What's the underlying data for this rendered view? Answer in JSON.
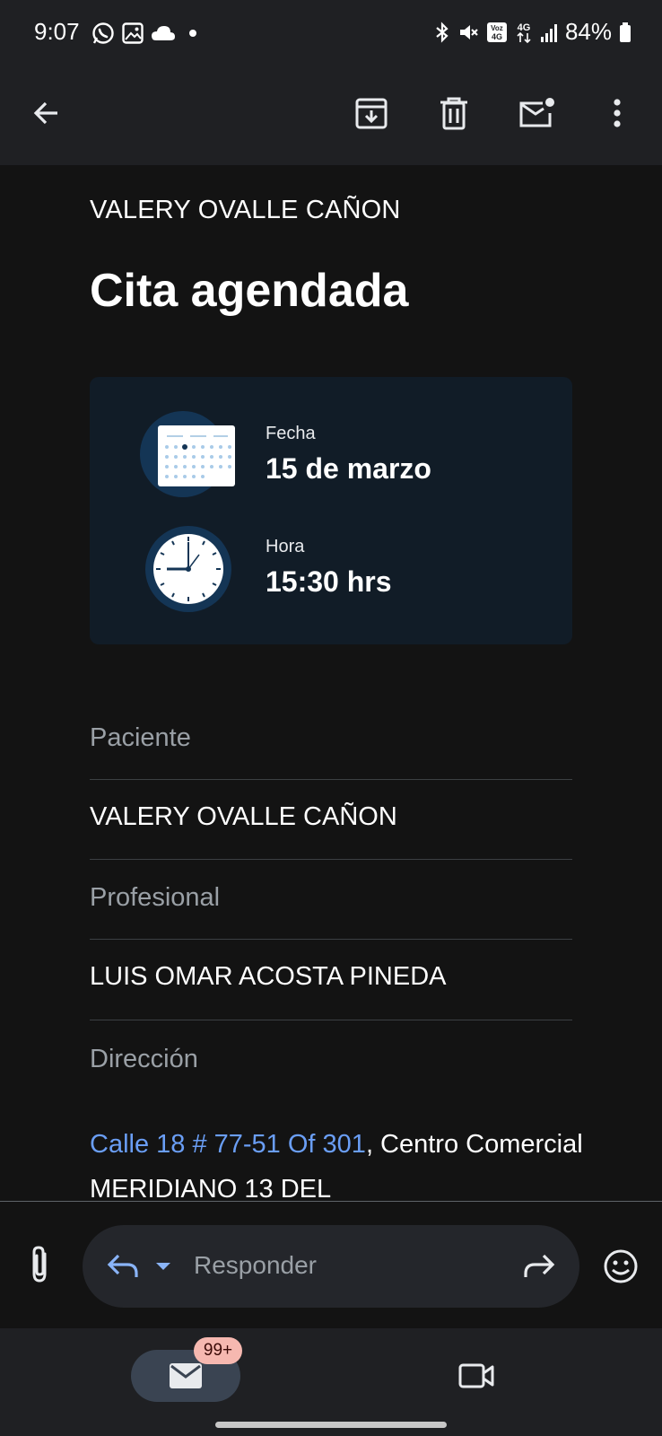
{
  "status_bar": {
    "time": "9:07",
    "left_icons": [
      "whatsapp-icon",
      "image-icon",
      "cloud-icon",
      "dot-icon"
    ],
    "right_icons": [
      "bluetooth-icon",
      "mute-icon",
      "volte-icon",
      "4g-icon",
      "signal-icon"
    ],
    "network_volte": "Voz 4G",
    "network_type": "4G",
    "battery": "84%"
  },
  "toolbar": {
    "back_icon": "arrow-back-icon",
    "archive_icon": "archive-icon",
    "delete_icon": "trash-icon",
    "mark_unread_icon": "mail-unread-icon",
    "more_icon": "more-vert-icon"
  },
  "email": {
    "sender": "VALERY OVALLE CAÑON",
    "title": "Cita agendada",
    "appointment": {
      "date_label": "Fecha",
      "date_value": "15 de marzo",
      "time_label": "Hora",
      "time_value": "15:30 hrs"
    },
    "fields": {
      "patient_label": "Paciente",
      "patient_value": "VALERY OVALLE CAÑON",
      "professional_label": "Profesional",
      "professional_value": "LUIS OMAR ACOSTA PINEDA",
      "address_label": "Dirección",
      "address_link": "Calle 18 # 77-51 Of 301",
      "address_rest": ", Centro Comercial MERIDIANO 13 DEL"
    }
  },
  "reply_bar": {
    "placeholder": "Responder",
    "attach_icon": "paperclip-icon",
    "reply_icon": "reply-icon",
    "dropdown_icon": "caret-down-icon",
    "forward_icon": "forward-icon",
    "emoji_icon": "emoji-icon"
  },
  "bottom_nav": {
    "mail_icon": "mail-icon",
    "mail_badge": "99+",
    "meet_icon": "video-icon"
  },
  "colors": {
    "background": "#131313",
    "bar": "#1f2023",
    "card": "#111c27",
    "link": "#6a9ef5",
    "badge": "#f6b8b0"
  }
}
